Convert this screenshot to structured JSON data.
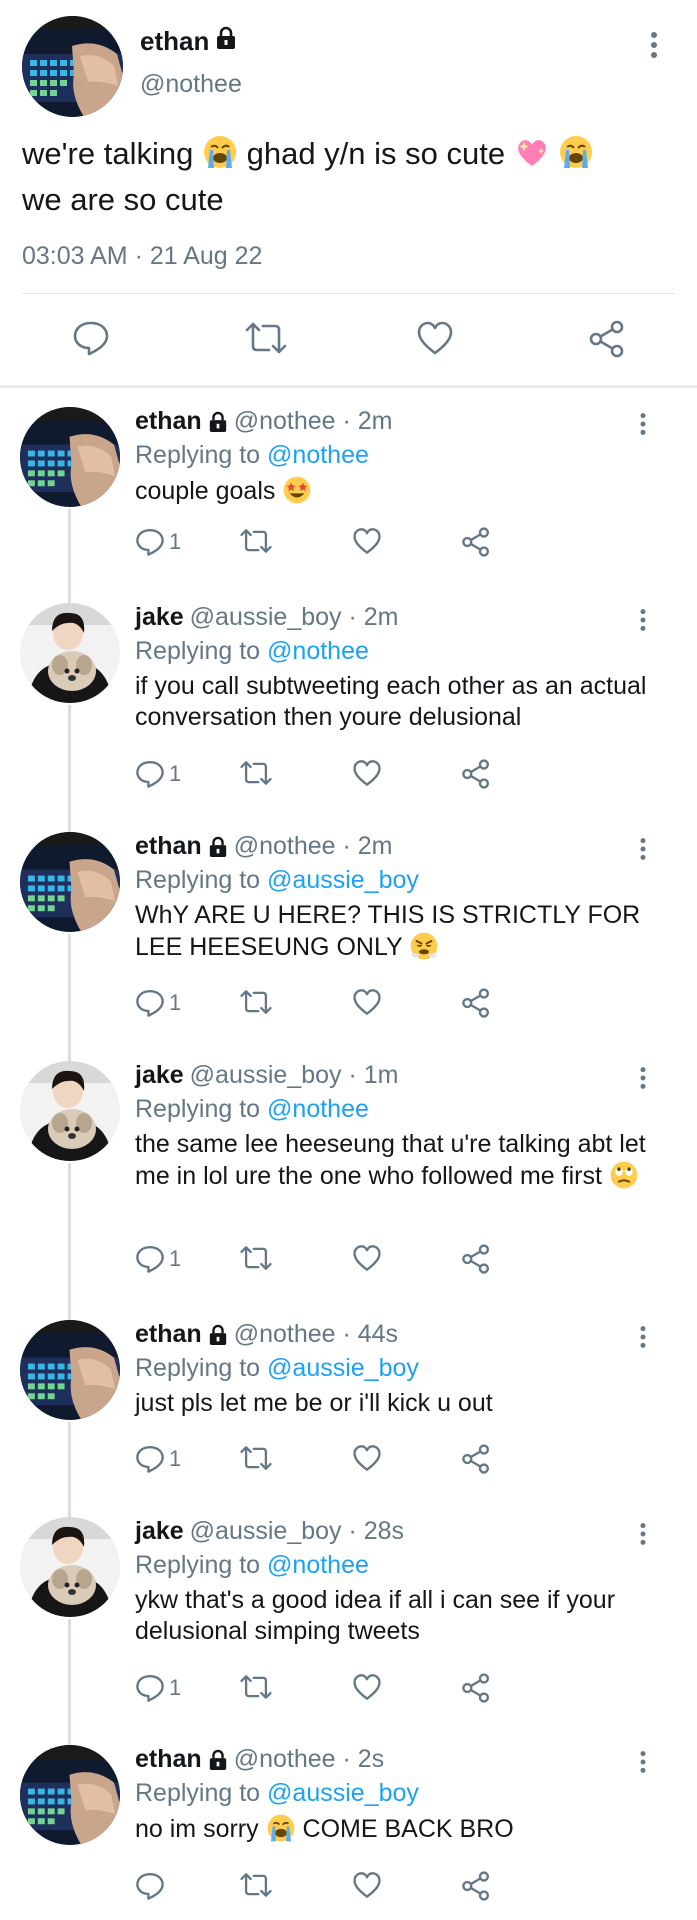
{
  "main_tweet": {
    "name": "ethan",
    "handle": "@nothee",
    "text_parts": [
      "we're talking",
      "ghad y/n is so cute",
      "we are so cute"
    ],
    "timestamp": "03:03 AM · 21 Aug 22",
    "icons": [
      "lock-icon",
      "more-icon",
      "reply-icon",
      "retweet-icon",
      "like-icon",
      "share-icon"
    ]
  },
  "replies": [
    {
      "name": "ethan",
      "handle": "@nothee",
      "time": "· 2m",
      "replying_label": "Replying to",
      "replying_to": "@nothee",
      "text": "couple goals",
      "reply_count": "1"
    },
    {
      "name": "jake",
      "handle": "@aussie_boy",
      "time": "· 2m",
      "replying_label": "Replying to",
      "replying_to": "@nothee",
      "text": "if you call subtweeting each other as an actual conversation then youre delusional",
      "reply_count": "1"
    },
    {
      "name": "ethan",
      "handle": "@nothee",
      "time": "· 2m",
      "replying_label": "Replying to",
      "replying_to": "@aussie_boy",
      "text": "WhY ARE U HERE? THIS IS STRICTLY FOR LEE HEESEUNG ONLY",
      "reply_count": "1"
    },
    {
      "name": "jake",
      "handle": "@aussie_boy",
      "time": "· 1m",
      "replying_label": "Replying to",
      "replying_to": "@nothee",
      "text": "the same lee heeseung that u're talking abt let me in lol ure the one who followed me first",
      "reply_count": "1"
    },
    {
      "name": "ethan",
      "handle": "@nothee",
      "time": "· 44s",
      "replying_label": "Replying to",
      "replying_to": "@aussie_boy",
      "text": "just pls let me be or i'll kick u out",
      "reply_count": "1"
    },
    {
      "name": "jake",
      "handle": "@aussie_boy",
      "time": "· 28s",
      "replying_label": "Replying to",
      "replying_to": "@nothee",
      "text": "ykw that's a good idea if all i can see if your delusional simping tweets",
      "reply_count": "1"
    },
    {
      "name": "ethan",
      "handle": "@nothee",
      "time": "· 2s",
      "replying_label": "Replying to",
      "replying_to": "@aussie_boy",
      "text_before": "no im sorry",
      "text_after": "COME BACK BRO",
      "reply_count": ""
    }
  ],
  "colors": {
    "text": "#14171a",
    "muted": "#657786",
    "link": "#1da1f2",
    "divider": "#e1e8ed"
  }
}
